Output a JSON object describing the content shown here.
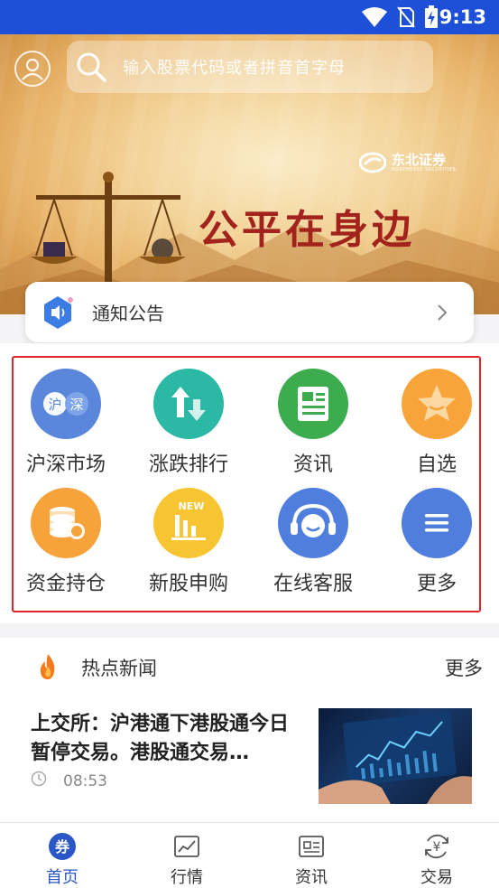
{
  "status_bar": {
    "time": "9:13"
  },
  "header": {
    "search_placeholder": "输入股票代码或者拼音首字母"
  },
  "banner": {
    "brand_name": "东北证券",
    "brand_sub": "NORTHEAST SECURITIES",
    "slogan": "公平在身边"
  },
  "notice": {
    "label": "通知公告"
  },
  "grid": {
    "items": [
      {
        "label": "沪深市场",
        "icon": "hushen-market-icon",
        "badge_a": "沪",
        "badge_b": "深",
        "color": "#5a86dc"
      },
      {
        "label": "涨跌排行",
        "icon": "up-down-ranking-icon",
        "color": "#2bb9a6"
      },
      {
        "label": "资讯",
        "icon": "news-icon",
        "color": "#3dac4f"
      },
      {
        "label": "自选",
        "icon": "star-icon",
        "color": "#f8a43b"
      },
      {
        "label": "资金持仓",
        "icon": "coins-icon",
        "color": "#f7a23a"
      },
      {
        "label": "新股申购",
        "icon": "new-stock-icon",
        "badge": "NEW",
        "color": "#f7c531"
      },
      {
        "label": "在线客服",
        "icon": "headset-icon",
        "color": "#4f7ede"
      },
      {
        "label": "更多",
        "icon": "menu-icon",
        "color": "#4f7ede"
      }
    ]
  },
  "hot_news": {
    "title": "热点新闻",
    "more": "更多",
    "headline": "上交所：沪港通下港股通今日暂停交易。港股通交易…",
    "time": "08:53"
  },
  "tabbar": {
    "tabs": [
      {
        "label": "首页",
        "icon_text": "券",
        "active": true
      },
      {
        "label": "行情"
      },
      {
        "label": "资讯"
      },
      {
        "label": "交易",
        "icon_text": "¥"
      }
    ],
    "active_color": "#2a56c6"
  }
}
